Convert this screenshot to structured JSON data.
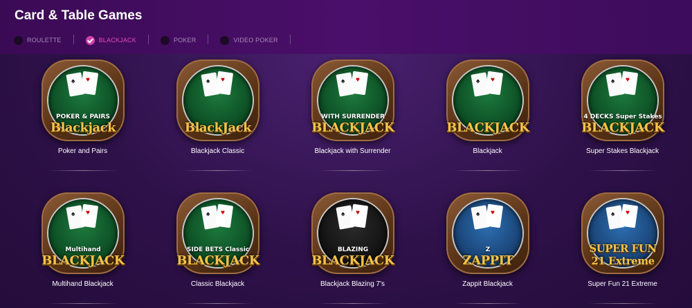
{
  "page": {
    "title": "Card & Table Games"
  },
  "tabs": [
    {
      "label": "ROULETTE",
      "active": false
    },
    {
      "label": "BLACKJACK",
      "active": true
    },
    {
      "label": "POKER",
      "active": false
    },
    {
      "label": "VIDEO POKER",
      "active": false
    }
  ],
  "colors": {
    "header_bg": "#4a0f6a",
    "content_bg": "#2e1149",
    "active_tab": "#e74bb7",
    "inactive_tab": "#a58bb8",
    "logo_gold": "#f3c34a"
  },
  "games": [
    {
      "label": "Poker and Pairs",
      "logo": "Blackjack",
      "logo_top": "POKER & PAIRS",
      "felt": "green"
    },
    {
      "label": "Blackjack Classic",
      "logo": "BlackJack",
      "logo_top": "",
      "felt": "green"
    },
    {
      "label": "Blackjack with Surrender",
      "logo": "BLACKJACK",
      "logo_top": "WITH SURRENDER",
      "felt": "green"
    },
    {
      "label": "Blackjack",
      "logo": "BLACKJACK",
      "logo_top": "",
      "felt": "green"
    },
    {
      "label": "Super Stakes Blackjack",
      "logo": "BLACKJACK",
      "logo_top": "4 DECKS Super Stakes",
      "felt": "green"
    },
    {
      "label": "Multihand Blackjack",
      "logo": "BLACKJACK",
      "logo_top": "Multihand",
      "felt": "green"
    },
    {
      "label": "Classic Blackjack",
      "logo": "BLACKJACK",
      "logo_top": "SIDE BETS Classic",
      "felt": "green"
    },
    {
      "label": "Blackjack Blazing 7's",
      "logo": "BLACKJACK",
      "logo_top": "BLAZING",
      "felt": "dark"
    },
    {
      "label": "Zappit Blackjack",
      "logo": "ZAPPIT",
      "logo_top": "Z",
      "felt": "blue"
    },
    {
      "label": "Super Fun 21 Extreme",
      "logo": "SUPER FUN 21 Extreme",
      "logo_top": "",
      "felt": "blue"
    }
  ]
}
